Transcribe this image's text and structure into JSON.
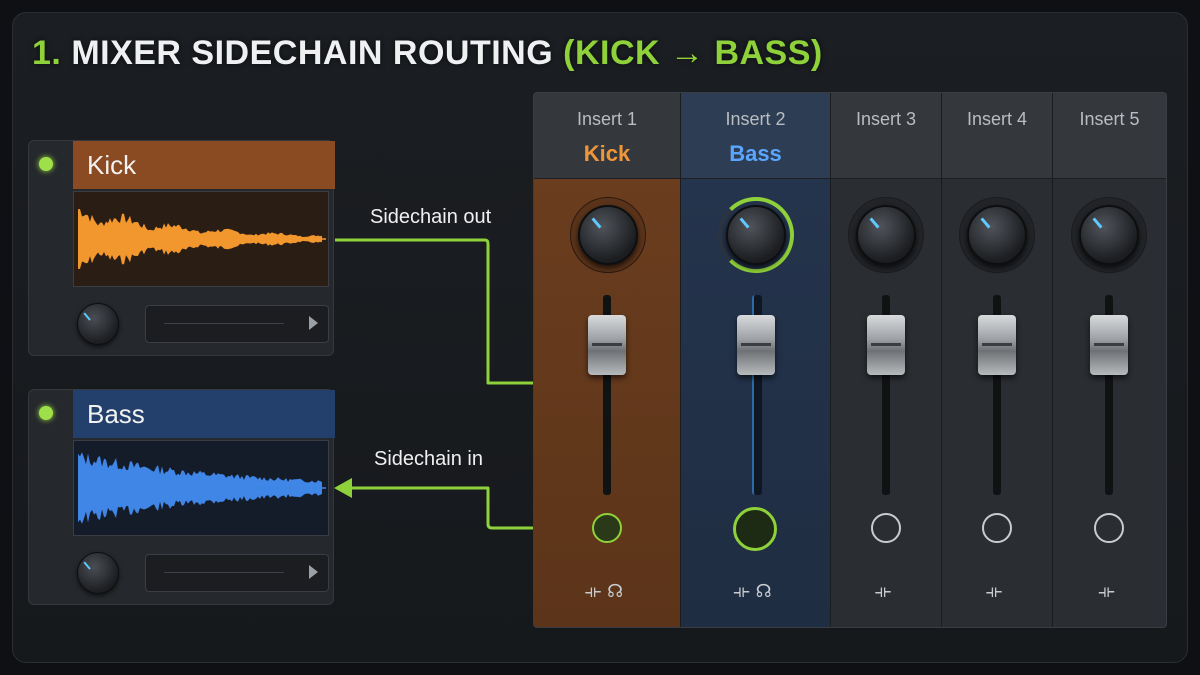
{
  "title": {
    "number": "1.",
    "main": "MIXER SIDECHAIN ROUTING",
    "sub": "(KICK → BASS)"
  },
  "channels": [
    {
      "name": "Kick",
      "color": "#8a4a22",
      "wave_color": "#f2972e"
    },
    {
      "name": "Bass",
      "color": "#23406c",
      "wave_color": "#3f86e6"
    }
  ],
  "routing": {
    "out_label": "Sidechain out",
    "in_label": "Sidechain in",
    "line_color": "#8fd13a"
  },
  "mixer": {
    "strips": [
      {
        "insert": "Insert 1",
        "track": "Kick",
        "track_color": "#f0963a",
        "bg": "#6a3d1e",
        "header_bg": "#3a3d40"
      },
      {
        "insert": "Insert 2",
        "track": "Bass",
        "track_color": "#5aa6ff",
        "bg": "#24344c",
        "header_bg": "#2d3d54"
      },
      {
        "insert": "Insert 3",
        "track": "",
        "track_color": "#ffffff",
        "bg": "#2a2d31",
        "header_bg": "#34383c"
      },
      {
        "insert": "Insert 4",
        "track": "",
        "track_color": "#ffffff",
        "bg": "#2a2d31",
        "header_bg": "#34383c"
      },
      {
        "insert": "Insert 5",
        "track": "",
        "track_color": "#ffffff",
        "bg": "#2a2d31",
        "header_bg": "#34383c"
      }
    ],
    "strip_icons": [
      "stereo-split-icon",
      "headphones-icon"
    ],
    "unassigned_icon": "route-icon"
  }
}
